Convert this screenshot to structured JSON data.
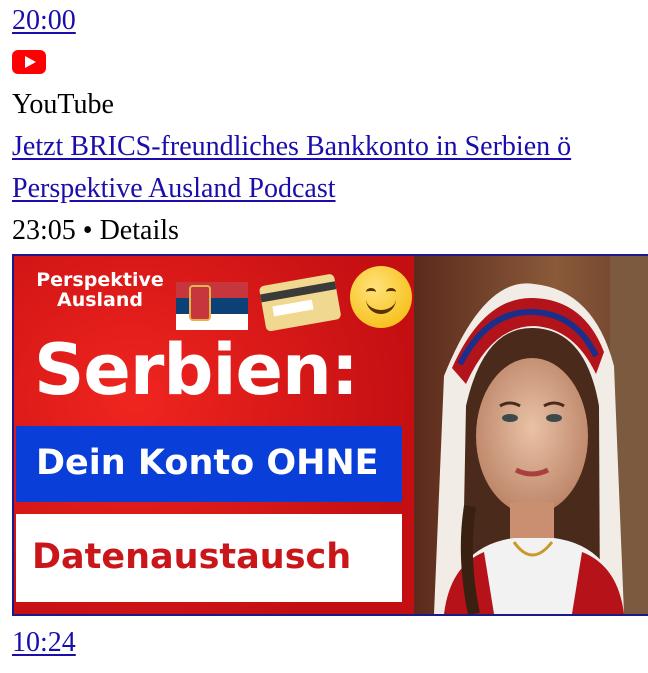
{
  "result_top": {
    "duration": "20:00"
  },
  "source": {
    "icon": "youtube-icon",
    "name": "YouTube"
  },
  "result": {
    "title": "Jetzt BRICS-freundliches Bankkonto in Serbien ö",
    "channel": "Perspektive Ausland Podcast",
    "meta": "23:05 • Details",
    "thumbnail": {
      "brand_text": "Perspektive Ausland",
      "headline": "Serbien:",
      "line_blue": "Dein Konto OHNE",
      "line_white": "Datenaustausch",
      "colors": {
        "background": "#e01a1a",
        "blue_bar": "#0a3ed8",
        "white_bar": "#ffffff",
        "accent_text": "#c8161a"
      }
    }
  },
  "result_next": {
    "duration": "10:24"
  }
}
